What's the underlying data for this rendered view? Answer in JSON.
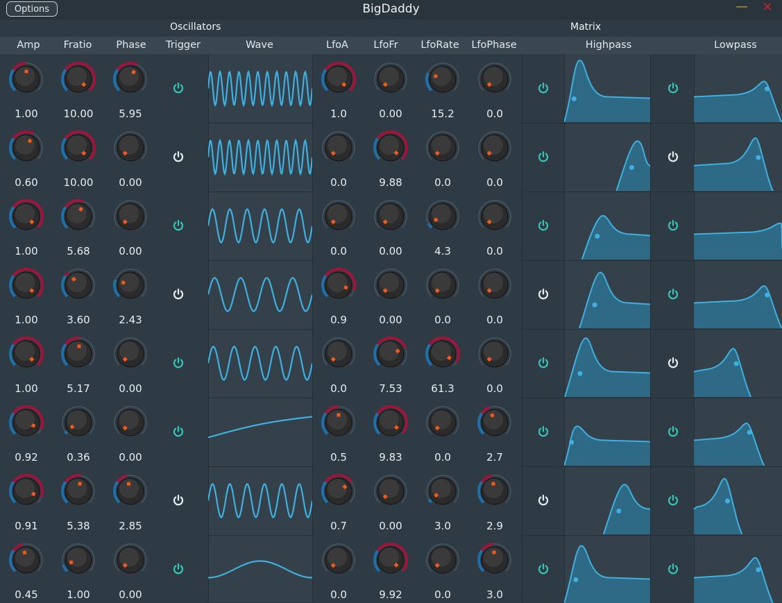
{
  "window": {
    "title": "BigDaddy",
    "options_label": "Options",
    "minimize_icon": "minimize-icon",
    "close_icon": "close-icon",
    "colors": {
      "background": "#2f3b44",
      "knob_body": "#2b2b2b",
      "knob_ring_blue": "#1f6fa8",
      "knob_ring_red": "#a0143a",
      "indicator": "#f05a1e",
      "power_on": "#36c6b8",
      "power_off": "#e8eef1",
      "wave": "#3fb0e0",
      "curve_fill": "#2a8cb8"
    }
  },
  "sections": {
    "oscillators": "Oscillators",
    "matrix": "Matrix"
  },
  "columns": {
    "amp": "Amp",
    "fratio": "Fratio",
    "phase": "Phase",
    "trigger": "Trigger",
    "wave": "Wave",
    "lfoa": "LfoA",
    "lfofr": "LfoFr",
    "lforate": "LfoRate",
    "lfophase": "LfoPhase",
    "highpass": "Highpass",
    "lowpass": "Lowpass"
  },
  "rows": [
    {
      "amp": "1.00",
      "fratio": "10.00",
      "phase": "5.95",
      "trigger_on": true,
      "wave_cycles": 11,
      "wave_type": "sine",
      "lfoa": "1.0",
      "lfofr": "0.00",
      "lforate": "15.2",
      "lfophase": "0.0",
      "hp_on": true,
      "lp_on": true,
      "k": {
        "amp": 0.5,
        "fratio": 1.0,
        "phase": 0.59,
        "lfoa": 1.0,
        "lfofr": 0.0,
        "lforate": 0.25,
        "lfophase": 0.0
      },
      "hp": {
        "cut": 0.18,
        "res": 0.95
      },
      "lp": {
        "cut": 0.8,
        "res": 0.25
      }
    },
    {
      "amp": "0.60",
      "fratio": "10.00",
      "phase": "0.00",
      "trigger_on": false,
      "wave_cycles": 11,
      "wave_type": "sine",
      "lfoa": "0.0",
      "lfofr": "9.88",
      "lforate": "0.0",
      "lfophase": "0.0",
      "hp_on": true,
      "lp_on": false,
      "k": {
        "amp": 0.6,
        "fratio": 1.0,
        "phase": 0.0,
        "lfoa": 0.0,
        "lfofr": 0.99,
        "lforate": 0.0,
        "lfophase": 0.0
      },
      "hp": {
        "cut": 0.85,
        "res": 0.55
      },
      "lp": {
        "cut": 0.7,
        "res": 0.65
      }
    },
    {
      "amp": "1.00",
      "fratio": "5.68",
      "phase": "0.00",
      "trigger_on": true,
      "wave_cycles": 6,
      "wave_type": "sine",
      "lfoa": "0.0",
      "lfofr": "0.00",
      "lforate": "4.3",
      "lfophase": "0.0",
      "hp_on": true,
      "lp_on": true,
      "k": {
        "amp": 1.0,
        "fratio": 0.57,
        "phase": 0.0,
        "lfoa": 0.0,
        "lfofr": 0.0,
        "lforate": 0.07,
        "lfophase": 0.0
      },
      "hp": {
        "cut": 0.45,
        "res": 0.35
      },
      "lp": {
        "cut": 0.98,
        "res": 0.1
      }
    },
    {
      "amp": "1.00",
      "fratio": "3.60",
      "phase": "2.43",
      "trigger_on": false,
      "wave_cycles": 4,
      "wave_type": "sine",
      "lfoa": "0.9",
      "lfofr": "0.00",
      "lforate": "0.0",
      "lfophase": "0.0",
      "hp_on": false,
      "lp_on": true,
      "k": {
        "amp": 1.0,
        "fratio": 0.36,
        "phase": 0.24,
        "lfoa": 0.9,
        "lfofr": 0.0,
        "lforate": 0.0,
        "lfophase": 0.0
      },
      "hp": {
        "cut": 0.42,
        "res": 0.75
      },
      "lp": {
        "cut": 0.8,
        "res": 0.3
      }
    },
    {
      "amp": "1.00",
      "fratio": "5.17",
      "phase": "0.00",
      "trigger_on": true,
      "wave_cycles": 5,
      "wave_type": "sine",
      "lfoa": "0.0",
      "lfofr": "7.53",
      "lforate": "61.3",
      "lfophase": "0.0",
      "hp_on": true,
      "lp_on": false,
      "k": {
        "amp": 1.0,
        "fratio": 0.52,
        "phase": 0.0,
        "lfoa": 0.0,
        "lfofr": 0.75,
        "lforate": 0.95,
        "lfophase": 0.0
      },
      "hp": {
        "cut": 0.25,
        "res": 0.85
      },
      "lp": {
        "cut": 0.45,
        "res": 0.5
      }
    },
    {
      "amp": "0.92",
      "fratio": "0.36",
      "phase": "0.00",
      "trigger_on": true,
      "wave_cycles": 0.3,
      "wave_type": "slow",
      "lfoa": "0.5",
      "lfofr": "9.83",
      "lforate": "0.0",
      "lfophase": "2.7",
      "hp_on": true,
      "lp_on": true,
      "k": {
        "amp": 0.92,
        "fratio": 0.04,
        "phase": 0.0,
        "lfoa": 0.5,
        "lfofr": 0.98,
        "lforate": 0.0,
        "lfophase": 0.43
      },
      "hp": {
        "cut": 0.15,
        "res": 0.2
      },
      "lp": {
        "cut": 0.6,
        "res": 0.3
      }
    },
    {
      "amp": "0.91",
      "fratio": "5.38",
      "phase": "2.85",
      "trigger_on": false,
      "wave_cycles": 6,
      "wave_type": "sine",
      "lfoa": "0.7",
      "lfofr": "0.00",
      "lforate": "3.0",
      "lfophase": "2.9",
      "hp_on": false,
      "lp_on": true,
      "k": {
        "amp": 0.91,
        "fratio": 0.54,
        "phase": 0.45,
        "lfoa": 0.7,
        "lfofr": 0.0,
        "lforate": 0.05,
        "lfophase": 0.46
      },
      "hp": {
        "cut": 0.7,
        "res": 0.55
      },
      "lp": {
        "cut": 0.35,
        "res": 0.75
      }
    },
    {
      "amp": "0.45",
      "fratio": "1.00",
      "phase": "0.00",
      "trigger_on": true,
      "wave_cycles": 1,
      "wave_type": "slow",
      "lfoa": "0.0",
      "lfofr": "9.92",
      "lforate": "0.0",
      "lfophase": "3.0",
      "hp_on": true,
      "lp_on": true,
      "k": {
        "amp": 0.45,
        "fratio": 0.1,
        "phase": 0.0,
        "lfoa": 0.0,
        "lfofr": 0.99,
        "lforate": 0.0,
        "lfophase": 0.48
      },
      "hp": {
        "cut": 0.2,
        "res": 0.8
      },
      "lp": {
        "cut": 0.7,
        "res": 0.4
      }
    }
  ]
}
